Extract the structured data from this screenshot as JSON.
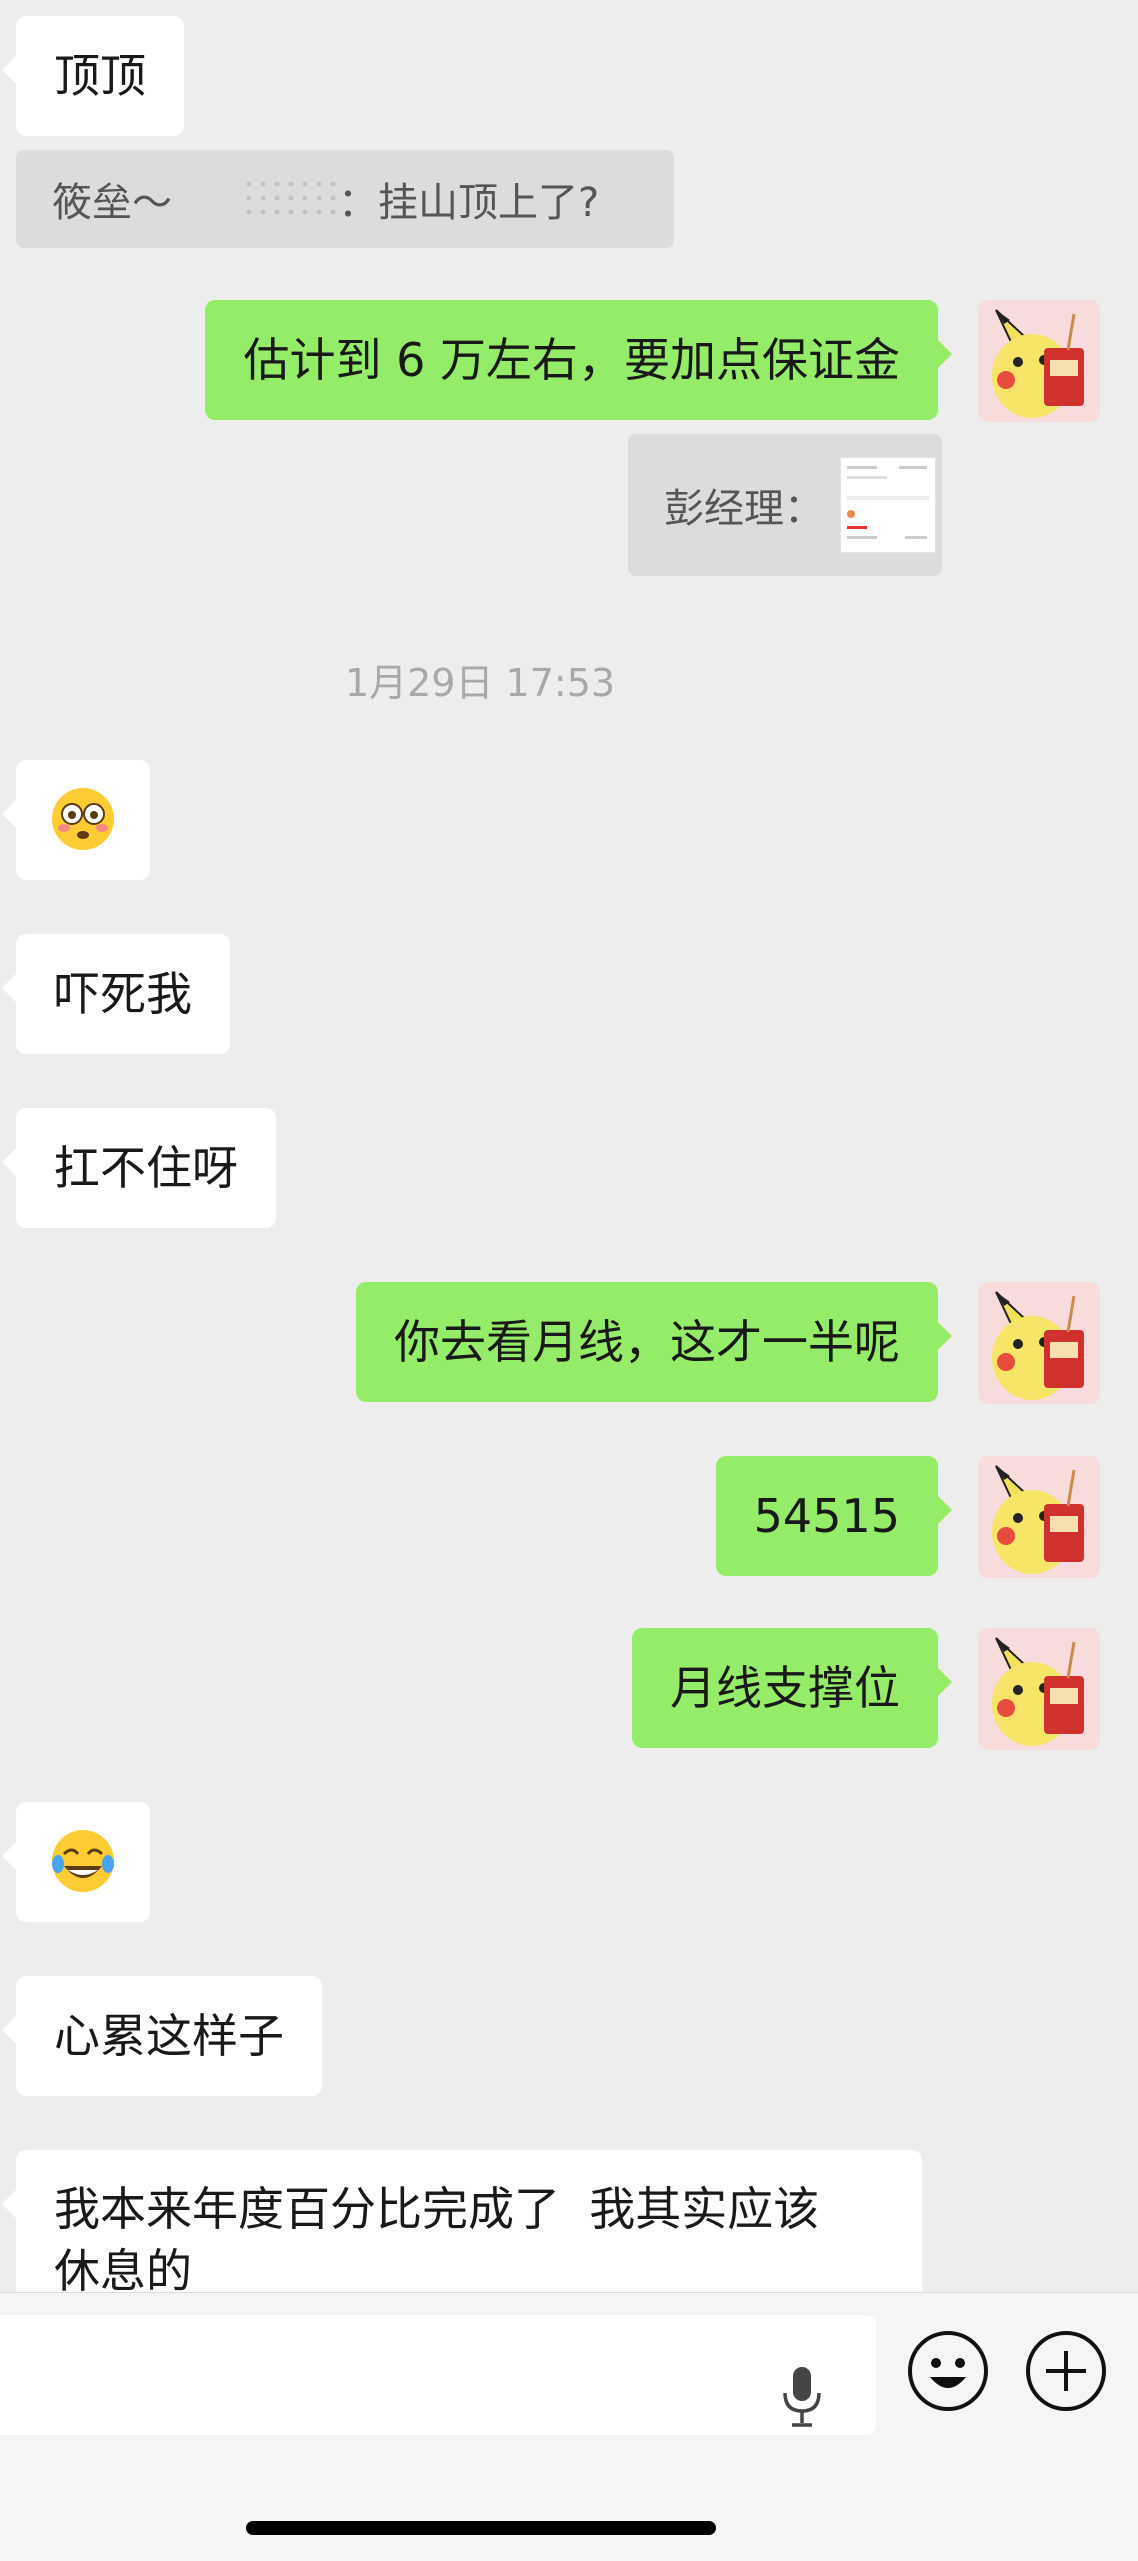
{
  "messages": {
    "m1": "顶顶",
    "q1_sender": "筱垒～",
    "q1_text": "：挂山顶上了?",
    "m2": "估计到 6 万左右，要加点保证金",
    "q2_sender": "彭经理：",
    "timestamp": "1月29日 17:53",
    "m3_emoji": "flushed-face",
    "m4": "吓死我",
    "m5": "扛不住呀",
    "m6": "你去看月线，这才一半呢",
    "m7": "54515",
    "m8": "月线支撑位",
    "m9_emoji": "tears-of-joy-face",
    "m10": "心累这样子",
    "m11_line1": "我本来年度百分比完成了  我其实应该",
    "m11_line2": "休息的"
  },
  "colors": {
    "background": "#ededed",
    "incoming_bubble": "#ffffff",
    "outgoing_bubble": "#95ec69",
    "quote_bg": "#dcdcdc"
  },
  "input_bar": {
    "icons": [
      "microphone-icon",
      "emoji-icon",
      "plus-icon"
    ]
  }
}
